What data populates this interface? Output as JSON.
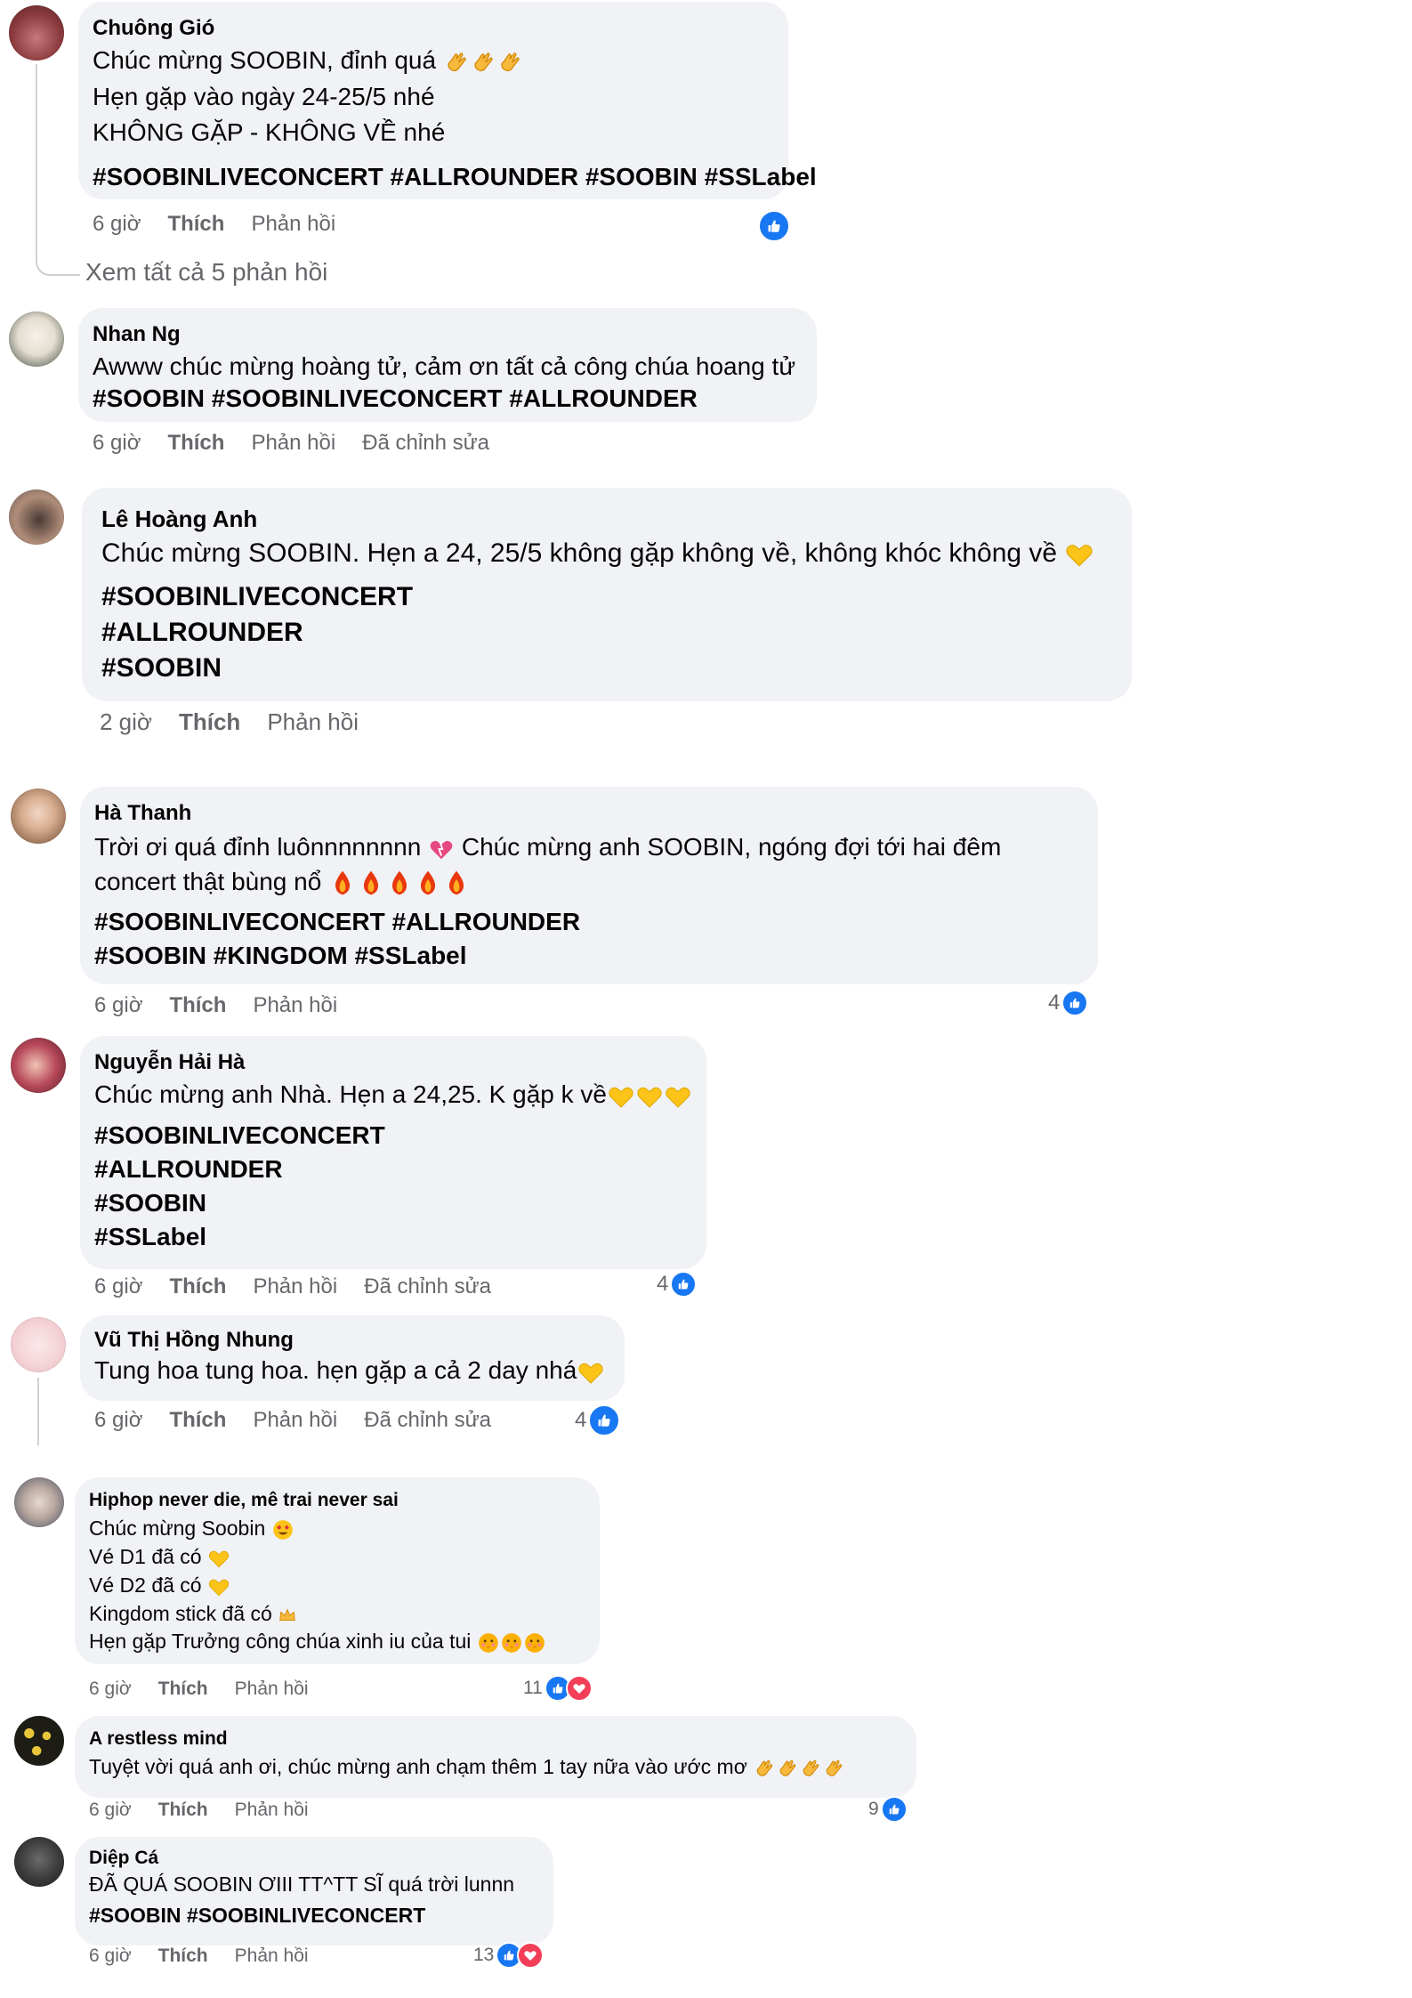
{
  "colors": {
    "bubble": "#f0f2f5",
    "meta_text": "#65676b",
    "like_blue": "#1877f2",
    "heart_red": "#f33e58"
  },
  "comments": [
    {
      "author": "Chuông Gió",
      "lines": [
        "Chúc mừng SOOBIN, đỉnh quá",
        "Hẹn gặp vào ngày 24-25/5 nhé",
        "KHÔNG GẶP - KHÔNG VỀ nhé"
      ],
      "tags": [
        "#SOOBINLIVECONCERT #ALLROUNDER #SOOBIN #SSLabel"
      ],
      "time": "6 giờ",
      "like": "Thích",
      "reply": "Phản hồi",
      "reactions": [
        "like-icon"
      ],
      "view_replies": "Xem tất cả 5 phản hồi"
    },
    {
      "author": "Nhan Ng",
      "lines": [
        "Awww chúc mừng hoàng tử, cảm ơn tất cả công chúa hoang tử"
      ],
      "tags": [
        "#SOOBIN #SOOBINLIVECONCERT #ALLROUNDER"
      ],
      "time": "6 giờ",
      "like": "Thích",
      "reply": "Phản hồi",
      "edited": "Đã chỉnh sửa"
    },
    {
      "author": "Lê Hoàng Anh",
      "lines": [
        "Chúc mừng SOOBIN. Hẹn a 24, 25/5 không gặp không về, không khóc không về"
      ],
      "tags": [
        "#SOOBINLIVECONCERT",
        "#ALLROUNDER",
        "#SOOBIN"
      ],
      "time": "2 giờ",
      "like": "Thích",
      "reply": "Phản hồi"
    },
    {
      "author": "Hà Thanh",
      "lines": [
        "Trời ơi quá đỉnh luônnnnnnnn",
        "Chúc mừng anh SOOBIN, ngóng đợi tới hai đêm",
        "concert thật bùng nổ"
      ],
      "tags": [
        "#SOOBINLIVECONCERT #ALLROUNDER",
        "#SOOBIN #KINGDOM #SSLabel"
      ],
      "time": "6 giờ",
      "like": "Thích",
      "reply": "Phản hồi",
      "reaction_count": "4",
      "reactions": [
        "like-icon"
      ]
    },
    {
      "author": "Nguyễn Hải Hà",
      "lines": [
        "Chúc mừng anh Nhà. Hẹn a 24,25. K gặp k về"
      ],
      "tags": [
        "#SOOBINLIVECONCERT",
        "#ALLROUNDER",
        "#SOOBIN",
        "#SSLabel"
      ],
      "time": "6 giờ",
      "like": "Thích",
      "reply": "Phản hồi",
      "edited": "Đã chỉnh sửa",
      "reaction_count": "4",
      "reactions": [
        "like-icon"
      ]
    },
    {
      "author": "Vũ Thị Hồng Nhung",
      "lines": [
        "Tung hoa tung hoa. hẹn gặp a cả 2 day nhá"
      ],
      "tags": [],
      "time": "6 giờ",
      "like": "Thích",
      "reply": "Phản hồi",
      "edited": "Đã chỉnh sửa",
      "reaction_count": "4",
      "reactions": [
        "like-icon"
      ]
    },
    {
      "author": "Hiphop never die, mê trai never sai",
      "lines": [
        "Chúc mừng Soobin",
        "Vé D1 đã có",
        "Vé D2 đã có",
        "Kingdom stick đã có",
        "Hẹn gặp Trưởng công chúa xinh iu của tui"
      ],
      "tags": [],
      "time": "6 giờ",
      "like": "Thích",
      "reply": "Phản hồi",
      "reaction_count": "11",
      "reactions": [
        "like-icon",
        "heart-icon"
      ]
    },
    {
      "author": "A restless mind",
      "lines": [
        "Tuyệt vời quá anh ơi, chúc mừng anh chạm thêm 1 tay nữa vào ước mơ"
      ],
      "tags": [],
      "time": "6 giờ",
      "like": "Thích",
      "reply": "Phản hồi",
      "reaction_count": "9",
      "reactions": [
        "like-icon"
      ]
    },
    {
      "author": "Diệp Cá",
      "lines": [
        "ĐÃ QUÁ SOOBIN ƠIII TT^TT SĨ quá trời lunnn"
      ],
      "tags": [
        "#SOOBIN #SOOBINLIVECONCERT"
      ],
      "time": "6 giờ",
      "like": "Thích",
      "reply": "Phản hồi",
      "reaction_count": "13",
      "reactions": [
        "like-icon",
        "heart-icon"
      ]
    }
  ]
}
